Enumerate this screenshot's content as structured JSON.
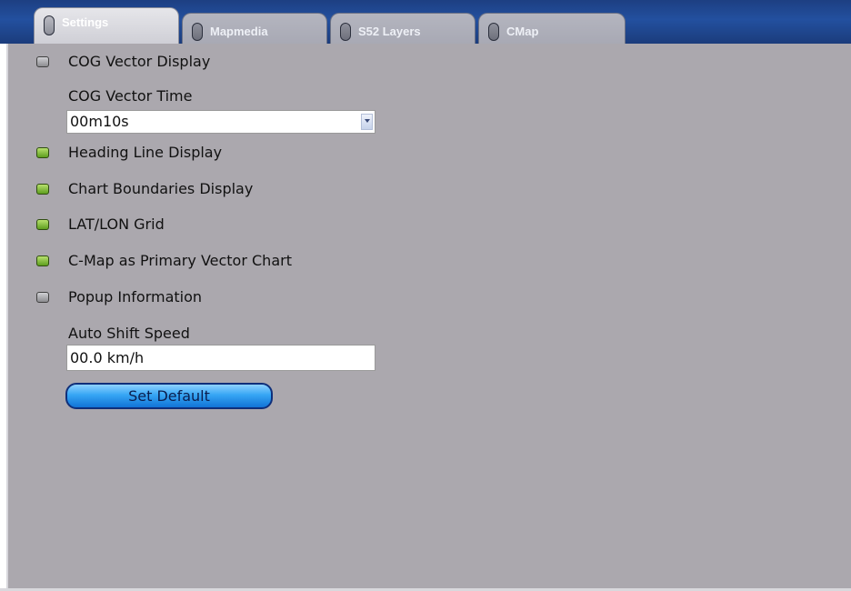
{
  "tabs": [
    {
      "label": "Settings",
      "active": true
    },
    {
      "label": "Mapmedia",
      "active": false
    },
    {
      "label": "S52 Layers",
      "active": false
    },
    {
      "label": "CMap",
      "active": false
    }
  ],
  "settings": {
    "cog_vector_display": {
      "label": "COG Vector Display",
      "state": "off"
    },
    "cog_vector_time": {
      "label": "COG Vector Time",
      "value": "00m10s"
    },
    "heading_line_display": {
      "label": "Heading Line Display",
      "state": "on"
    },
    "chart_boundaries_display": {
      "label": "Chart Boundaries Display",
      "state": "on"
    },
    "lat_lon_grid": {
      "label": "LAT/LON Grid",
      "state": "on"
    },
    "cmap_primary_vector_chart": {
      "label": "C-Map as Primary Vector Chart",
      "state": "on"
    },
    "popup_information": {
      "label": "Popup Information",
      "state": "off"
    },
    "auto_shift_speed": {
      "label": "Auto Shift Speed",
      "value": "00.0 km/h"
    },
    "set_default_label": "Set Default"
  },
  "colors": {
    "panel_bg": "#aba8ae",
    "header_bg": "#23509f",
    "led_on": "#7cc33a",
    "led_off": "#a8a8ac",
    "button": "#36a6f4"
  },
  "icons": {
    "tab_indicator": "tab-indicator-icon",
    "toggle_led": "toggle-led-icon",
    "dropdown": "chevron-down-icon"
  }
}
